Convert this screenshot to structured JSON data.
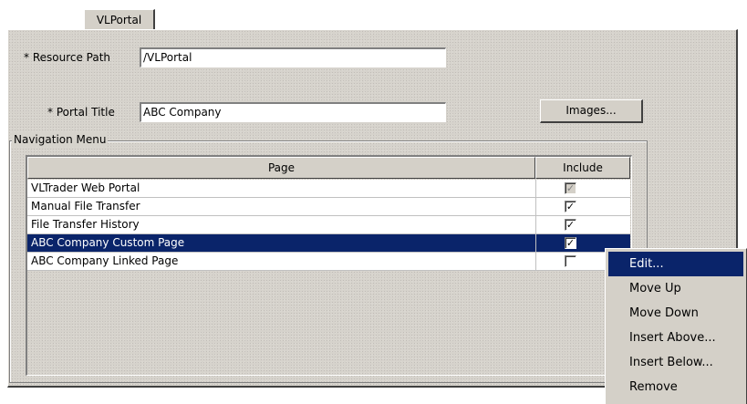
{
  "tab": {
    "label": "VLPortal"
  },
  "form": {
    "resource_path_label": "* Resource Path",
    "resource_path_value": "/VLPortal",
    "portal_title_label": "* Portal Title",
    "portal_title_value": "ABC Company",
    "images_button": "Images..."
  },
  "navigation": {
    "group_label": "Navigation Menu",
    "columns": [
      "Page",
      "Include"
    ],
    "rows": [
      {
        "page": "VLTrader Web Portal",
        "include": true,
        "disabled": true,
        "selected": false
      },
      {
        "page": "Manual File Transfer",
        "include": true,
        "disabled": false,
        "selected": false
      },
      {
        "page": "File Transfer History",
        "include": true,
        "disabled": false,
        "selected": false
      },
      {
        "page": "ABC Company Custom Page",
        "include": true,
        "disabled": false,
        "selected": true
      },
      {
        "page": "ABC Company Linked Page",
        "include": false,
        "disabled": false,
        "selected": false
      }
    ]
  },
  "context_menu": {
    "items": [
      "Edit...",
      "Move Up",
      "Move Down",
      "Insert Above...",
      "Insert Below...",
      "Remove"
    ],
    "active_index": 0
  },
  "colors": {
    "selection": "#0a246a",
    "face": "#d4d0c8"
  }
}
